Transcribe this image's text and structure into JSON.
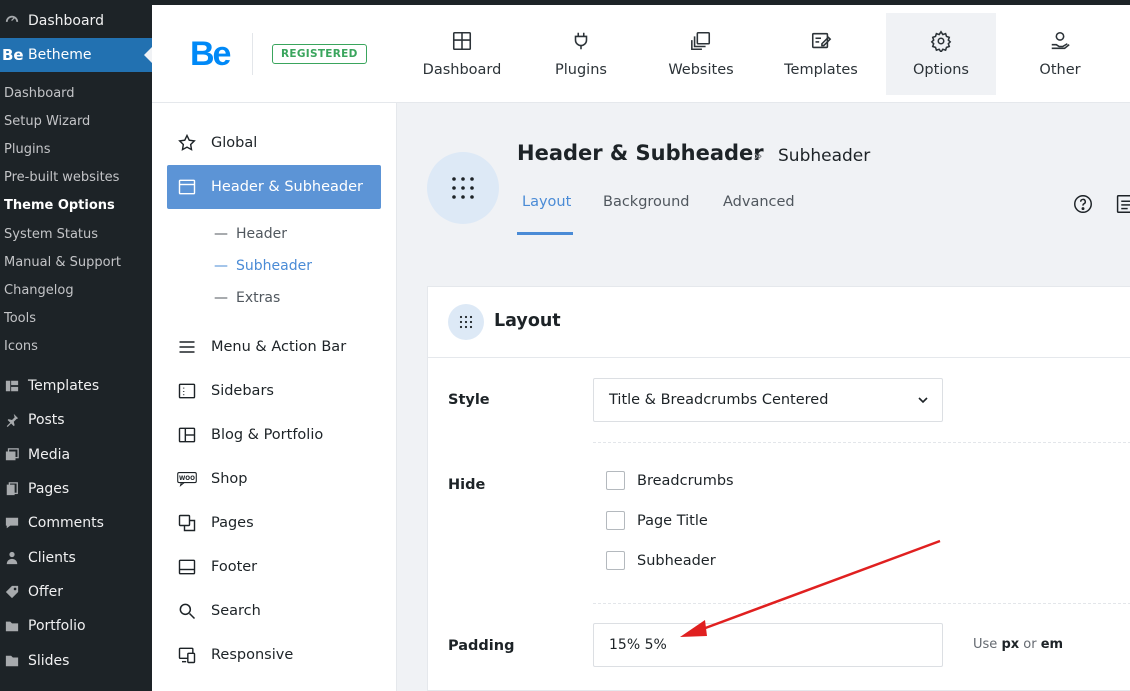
{
  "wp_sidebar": {
    "dashboard": "Dashboard",
    "betheme": "Betheme",
    "betheme_logo": "Be",
    "submenu": [
      "Dashboard",
      "Setup Wizard",
      "Plugins",
      "Pre-built websites",
      "Theme Options",
      "System Status",
      "Manual & Support",
      "Changelog",
      "Tools",
      "Icons"
    ],
    "active_submenu": "Theme Options",
    "lower": [
      {
        "label": "Templates",
        "icon": "templates-icon"
      },
      {
        "label": "Posts",
        "icon": "pin-icon"
      },
      {
        "label": "Media",
        "icon": "media-icon"
      },
      {
        "label": "Pages",
        "icon": "pages-icon"
      },
      {
        "label": "Comments",
        "icon": "comment-icon"
      },
      {
        "label": "Clients",
        "icon": "users-icon"
      },
      {
        "label": "Offer",
        "icon": "tag-icon"
      },
      {
        "label": "Portfolio",
        "icon": "folder-icon"
      },
      {
        "label": "Slides",
        "icon": "slides-icon"
      }
    ]
  },
  "header": {
    "logo": "Be",
    "badge": "REGISTERED",
    "nav": [
      {
        "label": "Dashboard",
        "icon": "dashboard-icon"
      },
      {
        "label": "Plugins",
        "icon": "plug-icon"
      },
      {
        "label": "Websites",
        "icon": "websites-icon"
      },
      {
        "label": "Templates",
        "icon": "templates-icon"
      },
      {
        "label": "Options",
        "icon": "gear-icon"
      },
      {
        "label": "Other",
        "icon": "user-hand-icon"
      }
    ],
    "active_nav": "Options"
  },
  "options_menu": {
    "items": [
      {
        "label": "Global",
        "icon": "star-icon"
      },
      {
        "label": "Header & Subheader",
        "icon": "header-icon"
      },
      {
        "label": "Menu & Action Bar",
        "icon": "menu-icon"
      },
      {
        "label": "Sidebars",
        "icon": "sidebar-icon"
      },
      {
        "label": "Blog & Portfolio",
        "icon": "blog-icon"
      },
      {
        "label": "Shop",
        "icon": "woo-icon"
      },
      {
        "label": "Pages",
        "icon": "pages-icon"
      },
      {
        "label": "Footer",
        "icon": "footer-icon"
      },
      {
        "label": "Search",
        "icon": "search-icon"
      },
      {
        "label": "Responsive",
        "icon": "responsive-icon"
      }
    ],
    "active_item": "Header & Subheader",
    "subitems": [
      "Header",
      "Subheader",
      "Extras"
    ],
    "active_subitem": "Subheader",
    "woo_text": "WOO"
  },
  "main": {
    "title": "Header & Subheader",
    "separator": "»",
    "subtitle": "Subheader",
    "tabs": [
      "Layout",
      "Background",
      "Advanced"
    ],
    "active_tab": "Layout"
  },
  "card": {
    "title": "Layout",
    "style": {
      "label": "Style",
      "value": "Title & Breadcrumbs Centered"
    },
    "hide": {
      "label": "Hide",
      "options": [
        "Breadcrumbs",
        "Page Title",
        "Subheader"
      ]
    },
    "padding": {
      "label": "Padding",
      "value": "15% 5%",
      "hint_prefix": "Use",
      "hint_px": "px",
      "hint_or": "or",
      "hint_em": "em"
    }
  },
  "colors": {
    "wp_bg": "#1d2327",
    "wp_active": "#2271b1",
    "accent": "#5c94d6",
    "logo": "#0089f7",
    "registered": "#3aa55d",
    "arrow": "#e02020"
  }
}
